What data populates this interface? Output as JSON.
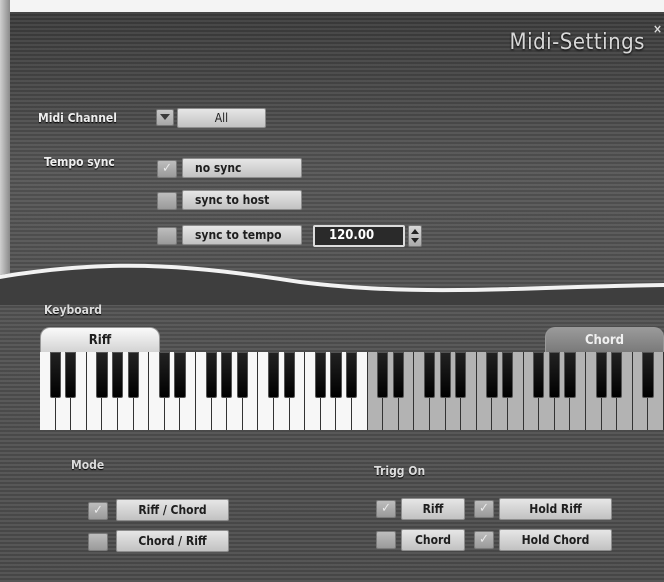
{
  "window": {
    "title": "Midi-Settings",
    "close_label": "×"
  },
  "midi_channel": {
    "label": "Midi Channel",
    "value": "All"
  },
  "tempo_sync": {
    "label": "Tempo sync",
    "options": [
      {
        "label": "no sync",
        "checked": true
      },
      {
        "label": "sync to host",
        "checked": false
      },
      {
        "label": "sync to tempo",
        "checked": false
      }
    ],
    "tempo_value": "120.00"
  },
  "keyboard": {
    "label": "Keyboard",
    "left_tab": "Riff",
    "right_tab": "Chord",
    "white_key_count": 40,
    "riff_white_keys": 21
  },
  "mode": {
    "label": "Mode",
    "options": [
      {
        "label": "Riff / Chord",
        "checked": true
      },
      {
        "label": "Chord / Riff",
        "checked": false
      }
    ]
  },
  "trigg_on": {
    "label": "Trigg On",
    "options": [
      {
        "label": "Riff",
        "checked": true
      },
      {
        "label": "Chord",
        "checked": false
      }
    ],
    "hold": [
      {
        "label": "Hold Riff",
        "checked": true
      },
      {
        "label": "Hold Chord",
        "checked": true
      }
    ]
  },
  "colors": {
    "riff_keys": "#f7f7f7",
    "chord_keys": "#b3b3b3",
    "panel": "#4a4a4a"
  }
}
